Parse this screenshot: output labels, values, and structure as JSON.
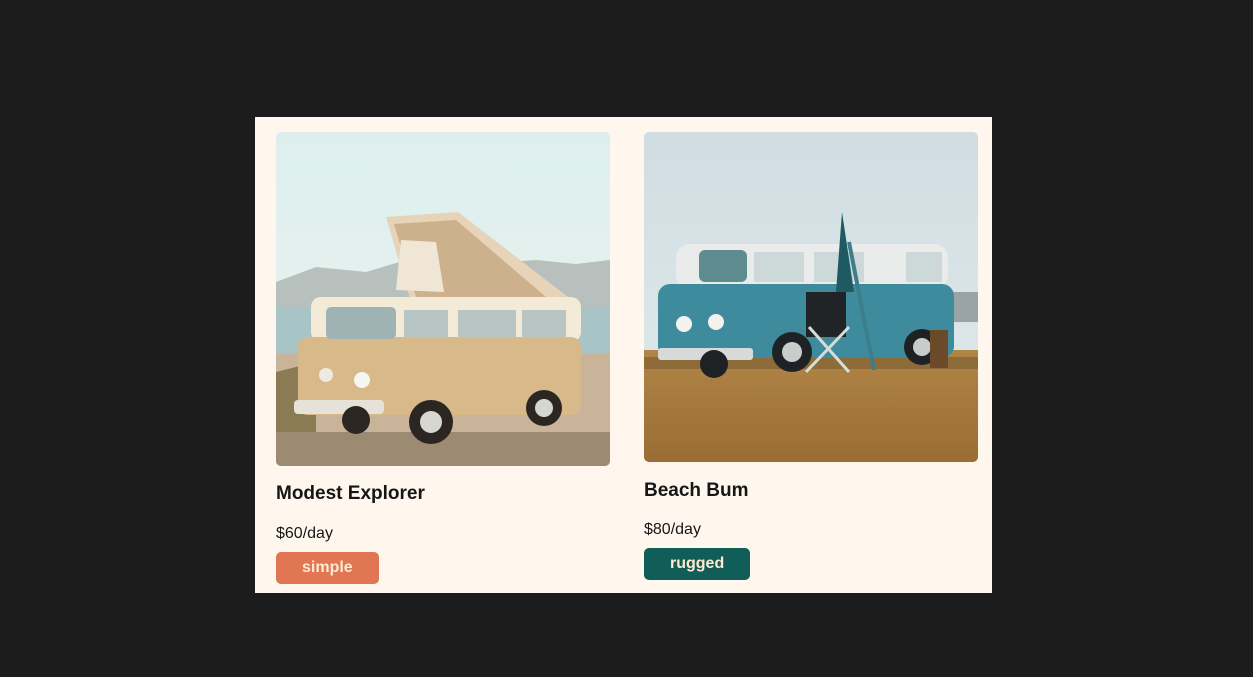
{
  "vans": [
    {
      "name": "Modest Explorer",
      "price": "$60/day",
      "type": "simple",
      "type_color": "#e17654",
      "image": "beige-vw-camper-van-icon"
    },
    {
      "name": "Beach Bum",
      "price": "$80/day",
      "type": "rugged",
      "type_color": "#115e59",
      "image": "teal-vw-bus-icon"
    }
  ]
}
